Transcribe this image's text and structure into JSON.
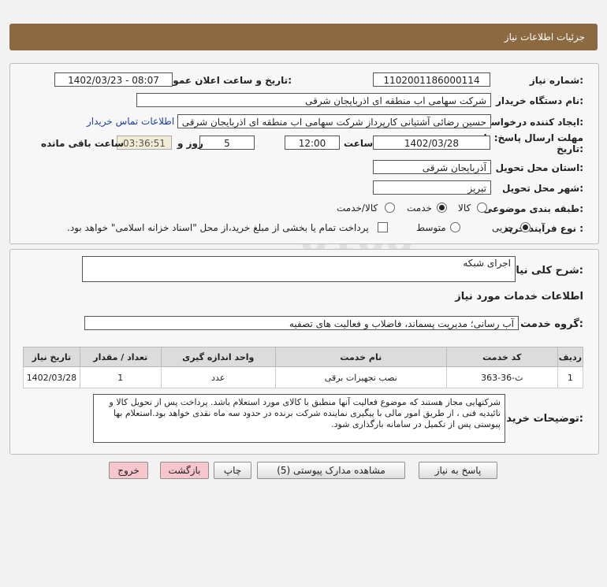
{
  "header": {
    "title": "جزئیات اطلاعات نیاز"
  },
  "labels": {
    "need_number": "شماره نیاز:",
    "announce_datetime": "تاریخ و ساعت اعلان عمومی:",
    "buyer_org": "نام دستگاه خریدار:",
    "requester": "ایجاد کننده درخواست:",
    "deadline_line1": "مهلت ارسال پاسخ: تا",
    "deadline_line2": "تاریخ:",
    "time_word": "ساعت",
    "days_word": "روز و",
    "remaining": "ساعت باقی مانده",
    "province": "استان محل تحویل:",
    "city": "شهر محل تحویل:",
    "category": "طبقه بندی موضوعی:",
    "process": "نوع فرآیند خرید :",
    "general_desc": "شرح کلی نیاز:",
    "services_info": "اطلاعات خدمات مورد نیاز",
    "service_group": "گروه خدمت:",
    "buyer_notes": "توضیحات خریدار:"
  },
  "fields": {
    "need_number": "1102001186000114",
    "announce_datetime": "1402/03/23 - 08:07",
    "buyer_org": "شرکت سهامی اب منطقه ای اذربایجان شرقی",
    "requester": "حسین رضائی آشتیانی کارپرداز شرکت سهامی اب منطقه ای اذربایجان شرقی",
    "contact_link": "اطلاعات تماس خریدار",
    "deadline_date": "1402/03/28",
    "deadline_time": "12:00",
    "days": "5",
    "remaining_time": "03:36:51",
    "province": "آذربایجان شرقی",
    "city": "تبریز",
    "general_desc": "اجرای شبکه",
    "service_group": "آب رسانی؛ مدیریت پسماند، فاضلاب و فعالیت های تصفیه",
    "buyer_notes": "شرکتهایی مجاز هستند که موضوع فعالیت آنها منطبق با کالای مورد استعلام باشد. پرداخت پس از تحویل کالا و تائیدیه فنی ، از طریق امور مالی با پیگیری نماینده شرکت برنده در حدود سه  ماه نقدی خواهد بود.استعلام بها پیوستی پس از تکمیل در سامانه بارگذاری شود."
  },
  "category_options": [
    {
      "label": "کالا",
      "selected": false
    },
    {
      "label": "خدمت",
      "selected": true
    },
    {
      "label": "کالا/خدمت",
      "selected": false
    }
  ],
  "process_options": [
    {
      "label": "جزیی",
      "selected": true
    },
    {
      "label": "متوسط",
      "selected": false
    }
  ],
  "treasury_note": "پرداخت تمام یا بخشی از مبلغ خرید،از محل \"اسناد خزانه اسلامی\" خواهد بود.",
  "table": {
    "headers": [
      "ردیف",
      "کد خدمت",
      "نام خدمت",
      "واحد اندازه گیری",
      "تعداد / مقدار",
      "تاریخ نیاز"
    ],
    "rows": [
      [
        "1",
        "ث-36-363",
        "نصب تجهیزات برقی",
        "عدد",
        "1",
        "1402/03/28"
      ]
    ]
  },
  "buttons": {
    "reply": "پاسخ به نیاز",
    "attachments": "مشاهده مدارک پیوستی (5)",
    "print": "چاپ",
    "back": "بازگشت",
    "exit": "خروج"
  }
}
